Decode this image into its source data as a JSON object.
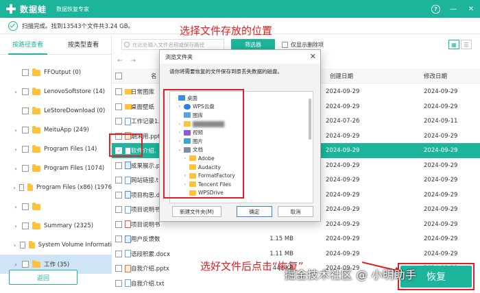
{
  "header": {
    "app_name": "数据蛙",
    "app_subtitle": "数据恢复专家",
    "help_label": "?",
    "minimize_label": "—",
    "close_label": "✕",
    "bg_color": "#1cb59c"
  },
  "status": {
    "text": "扫描完成。找到13543个文件共3.24 GB。"
  },
  "left_tabs": [
    {
      "label": "按路径查看"
    },
    {
      "label": "按类型查看"
    }
  ],
  "tree": [
    {
      "label": "FFOutput (0)",
      "expandable": false,
      "blurred": false
    },
    {
      "label": "LenovoSoftstore (14)",
      "expandable": true,
      "blurred": false
    },
    {
      "label": "LeStoreDownload (0)",
      "expandable": false,
      "blurred": false
    },
    {
      "label": "MeituApp (249)",
      "expandable": true,
      "blurred": false
    },
    {
      "label": "Program Files (14)",
      "expandable": true,
      "blurred": false
    },
    {
      "label": "Program Files (1074)",
      "expandable": true,
      "blurred": false
    },
    {
      "label": "Program Files (x86) (1976",
      "expandable": true,
      "blurred": false
    },
    {
      "label": "",
      "expandable": true,
      "blurred": true
    },
    {
      "label": "Summary (2325)",
      "expandable": true,
      "blurred": false
    },
    {
      "label": "System Volume Informati",
      "expandable": true,
      "blurred": false
    },
    {
      "label": "工作 (35)",
      "expandable": true,
      "blurred": false
    }
  ],
  "back_button": "返回",
  "toolbar": {
    "search_placeholder": "在此处输入文件名称或保存路径",
    "filter_label": "筛选器",
    "only_deleted_label": "仅显示删除项"
  },
  "table": {
    "col_name": "名",
    "col_create": "创建日期",
    "col_modify": "修改日期",
    "rows": [
      {
        "icon": "folder",
        "name": "日常图库",
        "size": "",
        "created": "2024-09-29",
        "modified": "2024-09-29",
        "highlight": false
      },
      {
        "icon": "folder",
        "name": "桌面壁纸",
        "size": "",
        "created": "2024-09-29",
        "modified": "2024-09-29",
        "highlight": false
      },
      {
        "icon": "doc",
        "name": "工作记录1.",
        "size": "",
        "created": "2024-07-26",
        "modified": "2024-09-11",
        "highlight": false
      },
      {
        "icon": "ppt",
        "name": "期末用.ppt",
        "size": "",
        "created": "2024-09-29",
        "modified": "2024-09-29",
        "highlight": false
      },
      {
        "icon": "doc",
        "name": "软件介绍.",
        "size": "",
        "created": "2024-09-29",
        "modified": "2024-09-29",
        "highlight": true
      },
      {
        "icon": "img",
        "name": "成果展示.p",
        "size": "",
        "created": "2024-09-29",
        "modified": "2024-09-29",
        "highlight": false
      },
      {
        "icon": "doc",
        "name": "网站链接.t",
        "size": "",
        "created": "2024-09-29",
        "modified": "2024-09-29",
        "highlight": false
      },
      {
        "icon": "img",
        "name": "项目构思.d",
        "size": "",
        "created": "2024-09-29",
        "modified": "2024-09-29",
        "highlight": false
      },
      {
        "icon": "doc",
        "name": "项目说明书",
        "size": "",
        "created": "2024-09-29",
        "modified": "2024-09-29",
        "highlight": false
      },
      {
        "icon": "pdf",
        "name": "项目说明书",
        "size": "",
        "created": "2024-09-29",
        "modified": "2024-09-29",
        "highlight": false
      },
      {
        "icon": "img",
        "name": "用户反馈数",
        "size": "1.15 MB",
        "created": "2024-09-29",
        "modified": "2024-09-29",
        "highlight": false
      },
      {
        "icon": "doc",
        "name": "语段积累.docx",
        "size": "1.11 MB",
        "created": "2024-09-29",
        "modified": "2024-09-29",
        "highlight": false
      },
      {
        "icon": "ppt",
        "name": "自我介绍.pptx",
        "size": "449 KB",
        "created": "2024-09-29",
        "modified": "2024-09-29",
        "highlight": false
      },
      {
        "icon": "doc",
        "name": "自我介绍.txt",
        "size": "",
        "created": "",
        "modified": "",
        "highlight": false
      }
    ]
  },
  "dialog": {
    "title": "浏览文件夹",
    "close_label": "✕",
    "description": "请你将需要恢复的文件保存到原丢失数据的磁盘。",
    "items": [
      {
        "label": "桌面",
        "icon": "desk",
        "indent": 0,
        "arrow": "",
        "blurred": false
      },
      {
        "label": "WPS云盘",
        "icon": "cloud",
        "indent": 1,
        "arrow": "›",
        "blurred": false
      },
      {
        "label": "图库",
        "icon": "lib",
        "indent": 1,
        "arrow": "",
        "blurred": false
      },
      {
        "label": "",
        "icon": "folder",
        "indent": 1,
        "arrow": "›",
        "blurred": true
      },
      {
        "label": "视频",
        "icon": "video",
        "indent": 1,
        "arrow": "›",
        "blurred": false
      },
      {
        "label": "图片",
        "icon": "pic",
        "indent": 1,
        "arrow": "›",
        "blurred": false
      },
      {
        "label": "文档",
        "icon": "doc",
        "indent": 1,
        "arrow": "⌄",
        "blurred": false
      },
      {
        "label": "Adobe",
        "icon": "folder",
        "indent": 2,
        "arrow": "›",
        "blurred": false
      },
      {
        "label": "Audacity",
        "icon": "folder",
        "indent": 2,
        "arrow": "",
        "blurred": false
      },
      {
        "label": "FormatFactory",
        "icon": "folder",
        "indent": 2,
        "arrow": "›",
        "blurred": false
      },
      {
        "label": "Tencent Files",
        "icon": "folder",
        "indent": 2,
        "arrow": "›",
        "blurred": false
      },
      {
        "label": "WPSDrive",
        "icon": "folder",
        "indent": 2,
        "arrow": "",
        "blurred": false
      }
    ],
    "new_folder_label": "新建文件夹(M)",
    "ok_label": "确定",
    "cancel_label": "取消"
  },
  "annotations": {
    "top_text": "选择文件存放的位置",
    "bottom_text": "选好文件后点击“恢复”",
    "color": "#e02020"
  },
  "next_button": "恢复",
  "watermark_text": "掘金技术社区 @ 小明助手"
}
